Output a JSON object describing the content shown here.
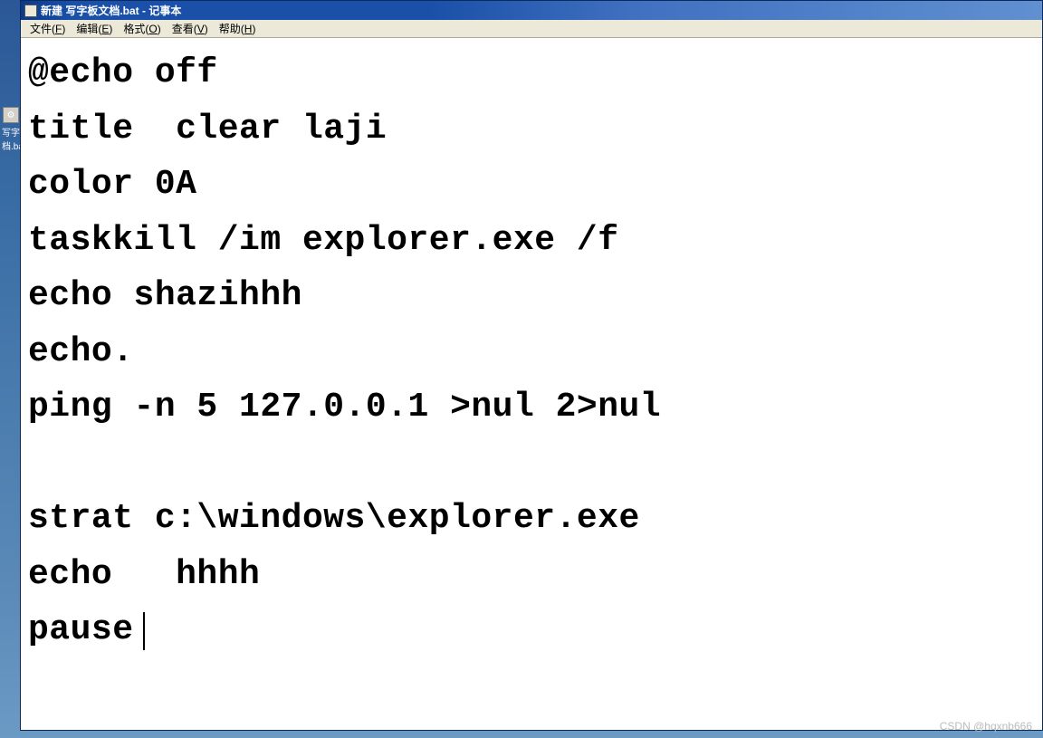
{
  "window": {
    "title": "新建 写字板文档.bat - 记事本",
    "icon_glyph": "📄"
  },
  "menu": {
    "items": [
      {
        "label": "文件",
        "hotkey": "F"
      },
      {
        "label": "编辑",
        "hotkey": "E"
      },
      {
        "label": "格式",
        "hotkey": "O"
      },
      {
        "label": "查看",
        "hotkey": "V"
      },
      {
        "label": "帮助",
        "hotkey": "H"
      }
    ]
  },
  "editor": {
    "content": "@echo off\ntitle  clear laji\ncolor 0A\ntaskkill /im explorer.exe /f\necho shazihhh\necho.\nping -n 5 127.0.0.1 >nul 2>nul\n\nstrat c:\\windows\\explorer.exe\necho   hhhh\npause"
  },
  "desktop": {
    "icon_label": "写字\n档.ba"
  },
  "watermark": "CSDN @hqxnb666"
}
